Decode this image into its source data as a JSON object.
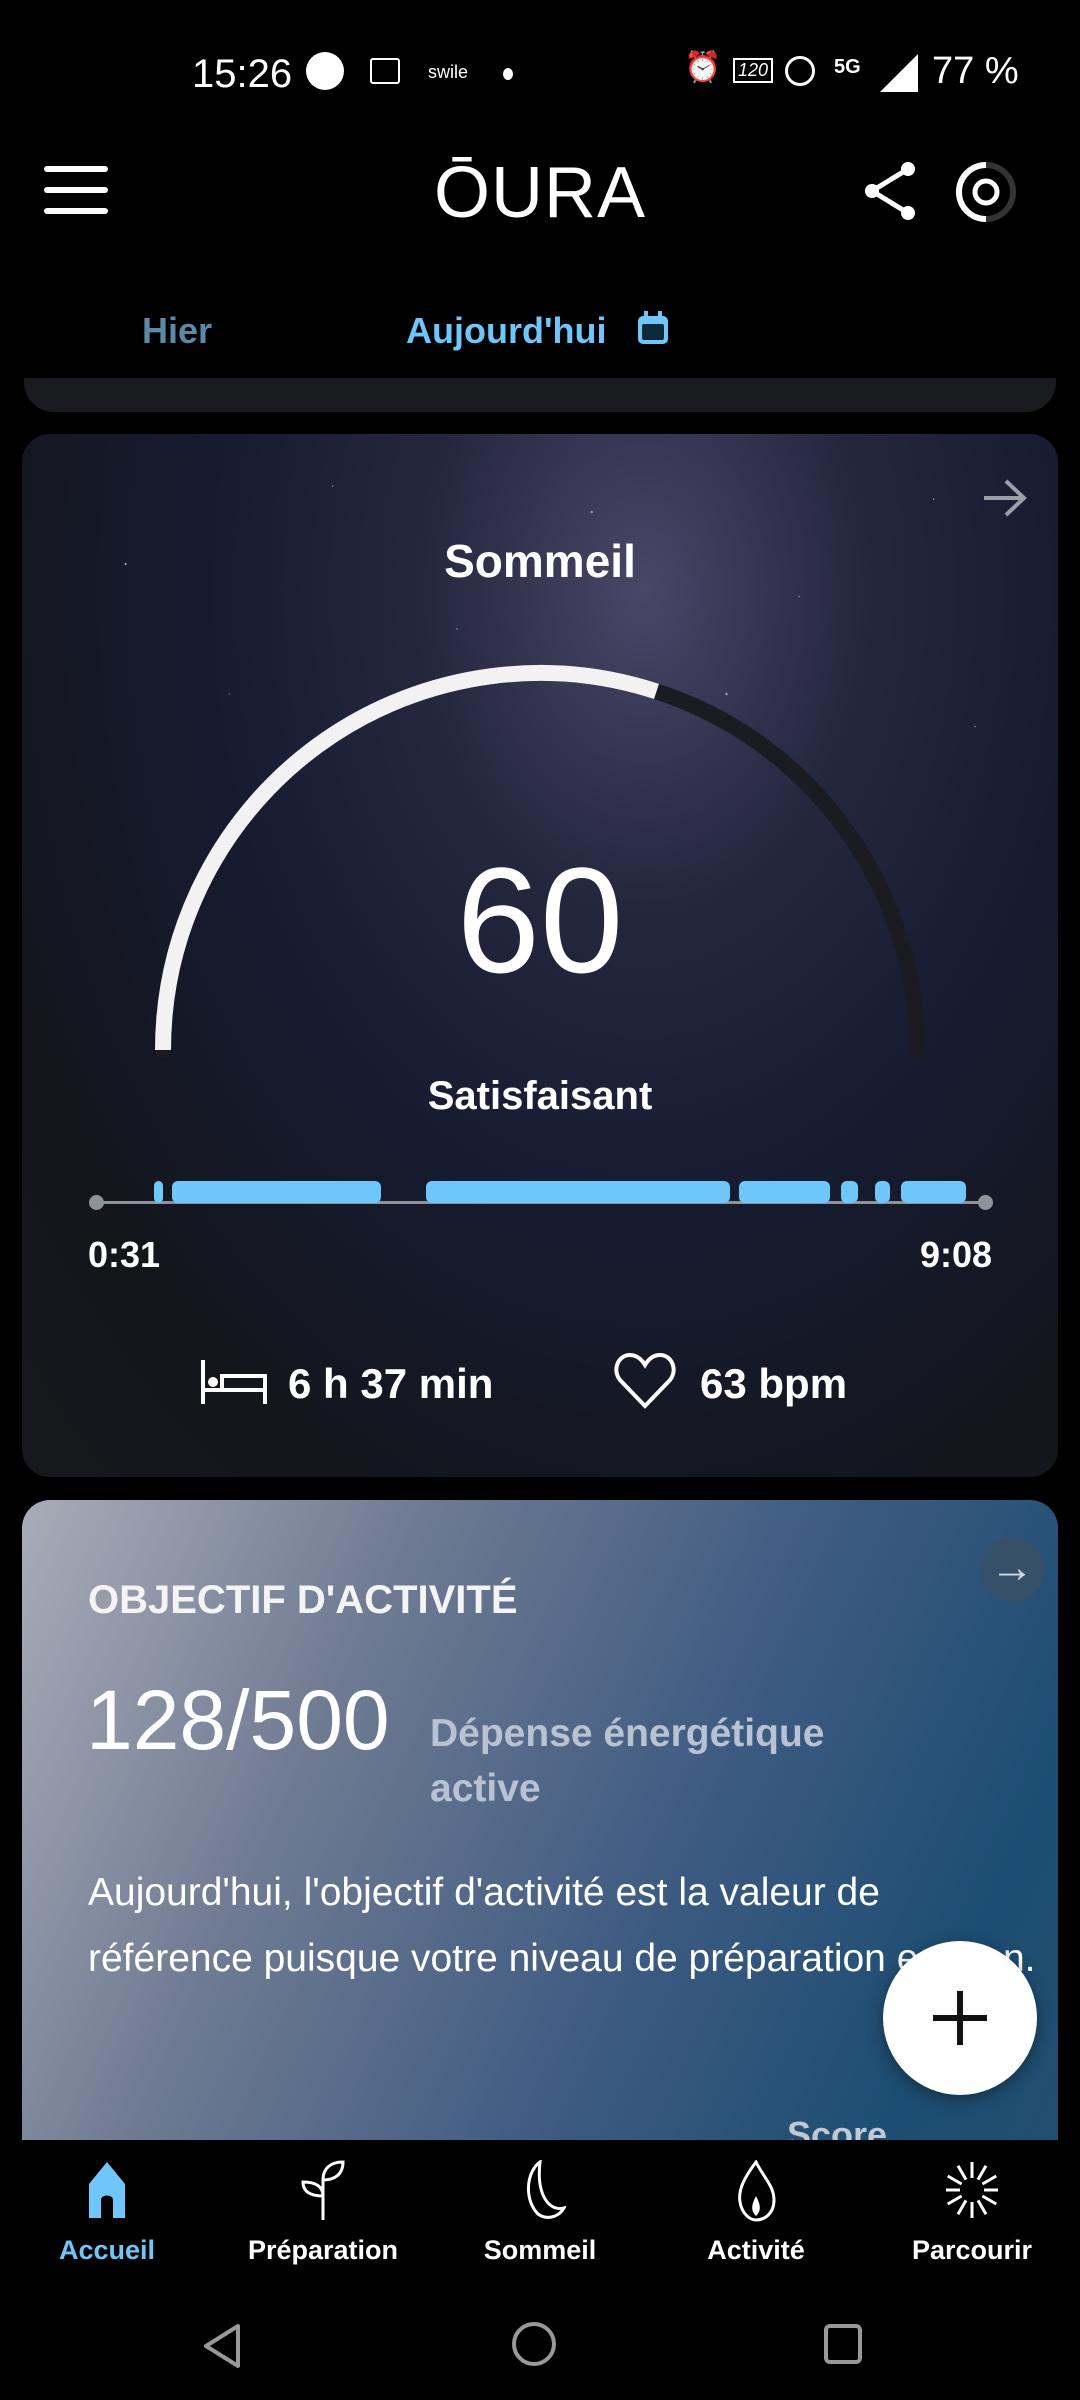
{
  "status_bar": {
    "time": "15:26",
    "notif_app": "swile",
    "battery": "77 %",
    "network": "5G",
    "refresh": "120"
  },
  "header": {
    "logo": "ŌURA"
  },
  "tabs": [
    {
      "label": "Hier",
      "active": false
    },
    {
      "label": "Aujourd'hui",
      "active": true
    }
  ],
  "sleep_card": {
    "title": "Sommeil",
    "score": 60,
    "score_max": 100,
    "rating": "Satisfaisant",
    "start_time": "0:31",
    "end_time": "9:08",
    "segments": [
      [
        "1:05",
        "1:10"
      ],
      [
        "1:15",
        "3:17"
      ],
      [
        "3:43",
        "6:40"
      ],
      [
        "6:45",
        "7:38"
      ],
      [
        "7:44",
        "7:54"
      ],
      [
        "8:04",
        "8:13"
      ],
      [
        "8:19",
        "8:57"
      ]
    ],
    "duration": "6 h 37 min",
    "heart_rate": "63 bpm",
    "accent": "#6ec6fb"
  },
  "activity_card": {
    "title": "OBJECTIF D'ACTIVITÉ",
    "value": "128/500",
    "value_label": "Dépense énergétique active",
    "description": "Aujourd'hui, l'objectif d'activité est la valeur de référence puisque votre niveau de préparation est bon.",
    "partial_label": "Score"
  },
  "bottom_nav": [
    {
      "label": "Accueil",
      "icon": "home-icon",
      "active": true
    },
    {
      "label": "Préparation",
      "icon": "sprout-icon"
    },
    {
      "label": "Sommeil",
      "icon": "moon-icon"
    },
    {
      "label": "Activité",
      "icon": "flame-icon"
    },
    {
      "label": "Parcourir",
      "icon": "burst-icon"
    }
  ]
}
